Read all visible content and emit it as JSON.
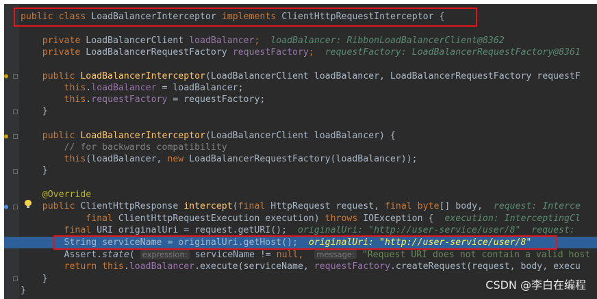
{
  "code": {
    "class_decl": {
      "kw_public": "public",
      "kw_class": "class",
      "class_name": "LoadBalancerInterceptor",
      "kw_implements": "implements",
      "iface": "ClientHttpRequestInterceptor",
      "brace": " {"
    },
    "field1": {
      "kw": "private",
      "type": "LoadBalancerClient",
      "name": "loadBalancer",
      "semi": ";",
      "hint": "loadBalancer: RibbonLoadBalancerClient@8362"
    },
    "field2": {
      "kw": "private",
      "type": "LoadBalancerRequestFactory",
      "name": "requestFactory",
      "semi": ";",
      "hint": "requestFactory: LoadBalancerRequestFactory@8361"
    },
    "ctor1": {
      "kw": "public",
      "name": "LoadBalancerInterceptor",
      "params": "(LoadBalancerClient loadBalancer, LoadBalancerRequestFactory requestF"
    },
    "ctor1_body1": {
      "this": "this",
      "field": "loadBalancer",
      "rest": " = loadBalancer;"
    },
    "ctor1_body2": {
      "this": "this",
      "field": "requestFactory",
      "rest": " = requestFactory;"
    },
    "close_brace": "}",
    "ctor2": {
      "kw": "public",
      "name": "LoadBalancerInterceptor",
      "params": "(LoadBalancerClient loadBalancer) {"
    },
    "ctor2_comment": "// for backwards compatibility",
    "ctor2_body": {
      "this": "this",
      "open": "(loadBalancer, ",
      "kw_new": "new",
      "rest": " LoadBalancerRequestFactory(loadBalancer));"
    },
    "override": "@Override",
    "method": {
      "kw_public": "public",
      "ret": "ClientHttpResponse ",
      "name": "intercept",
      "p1_kw": "final",
      "p1": " HttpRequest request, ",
      "p2_kw": "final",
      "p2_type": "byte",
      "p2": "[] body,",
      "hint": "request: Interce"
    },
    "method_l2": {
      "kw_final": "final",
      "p3": " ClientHttpRequestExecution execution) ",
      "kw_throws": "throws",
      "rest": " IOException {",
      "hint": "execution: InterceptingCl"
    },
    "uri_line": {
      "kw_final": "final",
      "rest": " URI originalUri = request.getURI();",
      "hint": "originalUri: \"http://user-service/user/8\"  request: "
    },
    "service_line": {
      "code": "String serviceName = originalUri.getHost();",
      "hint": "originalUri: \"http://user-service/user/8\""
    },
    "assert_line": {
      "pre": "Assert.",
      "fn": "state",
      "open": "(",
      "param1": "expression:",
      "arg1": "serviceName != ",
      "kw_null": "null",
      "comma": ",",
      "param2": "message:",
      "str": "\"Request URI does not contain a valid host"
    },
    "return_line": {
      "kw_return": "return",
      "this": " this",
      "dot": ".",
      "field": "loadBalancer",
      "mid": ".execute(serviceName, ",
      "field2": "requestFactory",
      "rest": ".createRequest(request, body, execu"
    },
    "final_brace": "}"
  },
  "watermark": "CSDN @李白在编程",
  "colors": {
    "background": "#2b2b2b",
    "highlight": "#2d5f9a",
    "annotation_box": "#e0161c"
  }
}
